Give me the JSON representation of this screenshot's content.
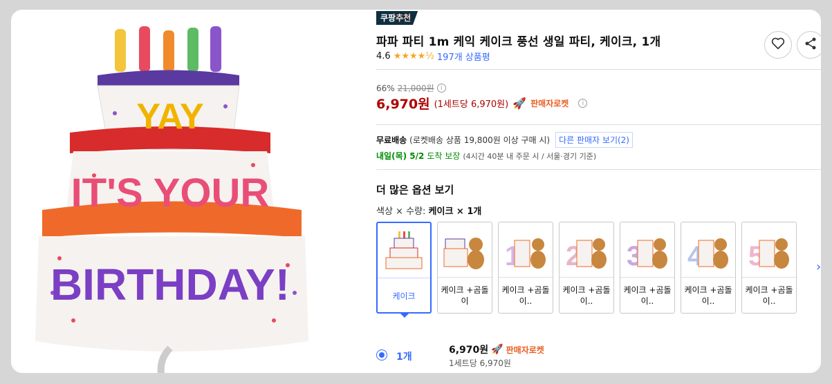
{
  "badge": {
    "prefix": "쿠팡",
    "accent": "추천"
  },
  "product": {
    "title": "파파 파티 1m 케익 케이크 풍선 생일 파티, 케이크, 1개",
    "rating": "4.6",
    "stars": "★★★★½",
    "review_count": "197개 상품평",
    "hero_text": {
      "line1": "YAY",
      "line2": "IT'S YOUR",
      "line3": "BIRTHDAY!"
    }
  },
  "price": {
    "discount_rate": "66%",
    "original": "21,000원",
    "sale": "6,970원",
    "unit": "(1세트당 6,970원)",
    "rocket_label": "판매자로켓"
  },
  "shipping": {
    "free_label": "무료배송",
    "condition": "(로켓배송 상품 19,800원 이상 구매 시)",
    "other_seller": "다른 판매자 보기(2)",
    "arrival": "내일(목) 5/2",
    "arrival_suffix": "도착 보장",
    "arrival_note": "(4시간 40분  내 주문 시 / 서울·경기 기준)"
  },
  "options": {
    "heading": "더 많은 옵션 보기",
    "selected_prefix": "색상 × 수량:",
    "selected_value": "케이크 × 1개",
    "items": [
      {
        "label": "케이크",
        "num": ""
      },
      {
        "label": "케이크 +곰돌이",
        "num": ""
      },
      {
        "label": "케이크 +곰돌이..",
        "num": "1"
      },
      {
        "label": "케이크 +곰돌이..",
        "num": "2"
      },
      {
        "label": "케이크 +곰돌이..",
        "num": "3"
      },
      {
        "label": "케이크 +곰돌이..",
        "num": "4"
      },
      {
        "label": "케이크 +곰돌이..",
        "num": "5"
      }
    ]
  },
  "quantity": {
    "label": "1개",
    "price": "6,970원",
    "rocket_label": "판매자로켓",
    "unit": "1세트당 6,970원"
  },
  "colors": {
    "accent": "#346aff",
    "price": "#ae0000",
    "rocket": "#e95e23",
    "arrival": "#008c00"
  },
  "icons": [
    "heart-icon",
    "share-icon",
    "info-icon",
    "rocket-icon",
    "chevron-right-icon"
  ]
}
